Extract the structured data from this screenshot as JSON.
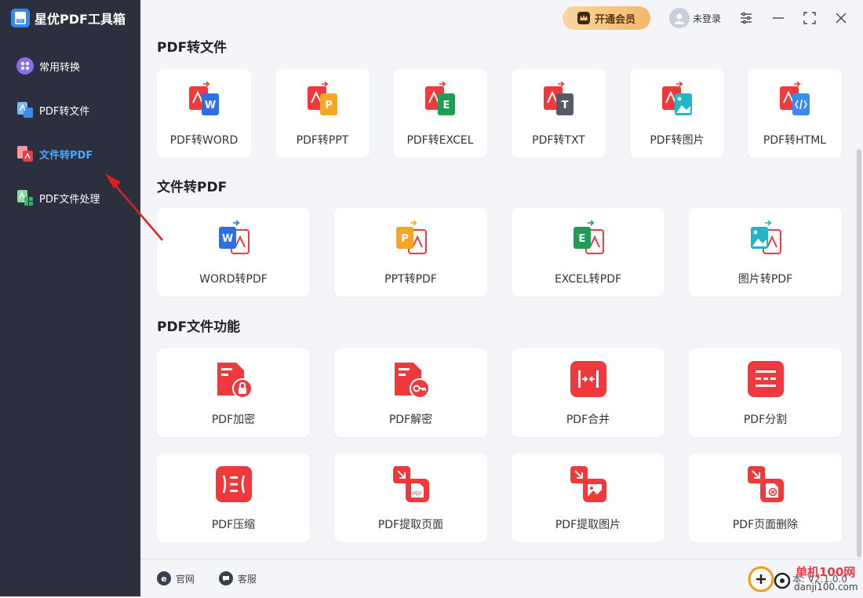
{
  "app": {
    "title": "星优PDF工具箱"
  },
  "sidebar": {
    "items": [
      {
        "label": "常用转换",
        "icon": "apps-icon",
        "active": false
      },
      {
        "label": "PDF转文件",
        "icon": "pdf-to-file-icon",
        "active": false
      },
      {
        "label": "文件转PDF",
        "icon": "file-to-pdf-icon",
        "active": true
      },
      {
        "label": "PDF文件处理",
        "icon": "pdf-process-icon",
        "active": false
      }
    ]
  },
  "header": {
    "vip_label": "开通会员",
    "user_label": "未登录"
  },
  "sections": [
    {
      "title": "PDF转文件",
      "cards": [
        {
          "label": "PDF转WORD",
          "icon": "pdf-to-word-icon",
          "color": "#2e6ee6"
        },
        {
          "label": "PDF转PPT",
          "icon": "pdf-to-ppt-icon",
          "color": "#f6a623"
        },
        {
          "label": "PDF转EXCEL",
          "icon": "pdf-to-excel-icon",
          "color": "#1f9d55"
        },
        {
          "label": "PDF转TXT",
          "icon": "pdf-to-txt-icon",
          "color": "#555a66"
        },
        {
          "label": "PDF转图片",
          "icon": "pdf-to-image-icon",
          "color": "#21b6c6"
        },
        {
          "label": "PDF转HTML",
          "icon": "pdf-to-html-icon",
          "color": "#3b8cf0"
        }
      ]
    },
    {
      "title": "文件转PDF",
      "cards": [
        {
          "label": "WORD转PDF",
          "icon": "word-to-pdf-icon",
          "color": "#2e6ee6"
        },
        {
          "label": "PPT转PDF",
          "icon": "ppt-to-pdf-icon",
          "color": "#f6a623"
        },
        {
          "label": "EXCEL转PDF",
          "icon": "excel-to-pdf-icon",
          "color": "#1f9d55"
        },
        {
          "label": "图片转PDF",
          "icon": "image-to-pdf-icon",
          "color": "#21b6c6"
        }
      ]
    },
    {
      "title": "PDF文件功能",
      "cards": [
        {
          "label": "PDF加密",
          "icon": "pdf-encrypt-icon"
        },
        {
          "label": "PDF解密",
          "icon": "pdf-decrypt-icon"
        },
        {
          "label": "PDF合并",
          "icon": "pdf-merge-icon"
        },
        {
          "label": "PDF分割",
          "icon": "pdf-split-icon"
        },
        {
          "label": "PDF压缩",
          "icon": "pdf-compress-icon"
        },
        {
          "label": "PDF提取页面",
          "icon": "pdf-extract-pages-icon"
        },
        {
          "label": "PDF提取图片",
          "icon": "pdf-extract-images-icon"
        },
        {
          "label": "PDF页面删除",
          "icon": "pdf-delete-pages-icon"
        }
      ]
    }
  ],
  "footer": {
    "website_label": "官网",
    "service_label": "客服",
    "version_prefix": "本:",
    "version": "V2.1.0.0"
  },
  "watermark": {
    "text": "单机100网",
    "url_text": "danji100.com"
  },
  "colors": {
    "sidebar_bg": "#2b2f3e",
    "accent_blue": "#4aa6ff",
    "pdf_red": "#f0393d",
    "vip_gold": "#f3b86a"
  }
}
